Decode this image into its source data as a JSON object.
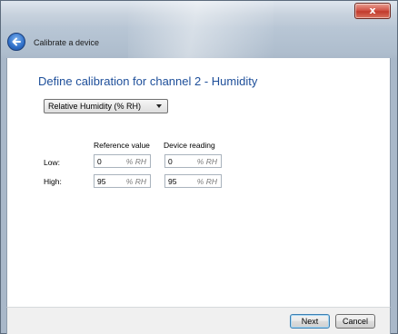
{
  "window": {
    "close_label": "x",
    "title": "Calibrate a device"
  },
  "main": {
    "heading": "Define calibration for channel 2 - Humidity",
    "unit_select": {
      "selected": "Relative Humidity (% RH)"
    },
    "columns": {
      "reference": "Reference value",
      "device": "Device reading"
    },
    "rows": [
      {
        "label": "Low:",
        "reference": "0",
        "reference_unit": "% RH",
        "device": "0",
        "device_unit": "% RH"
      },
      {
        "label": "High:",
        "reference": "95",
        "reference_unit": "% RH",
        "device": "95",
        "device_unit": "% RH"
      }
    ]
  },
  "footer": {
    "next_label": "Next",
    "cancel_label": "Cancel"
  },
  "icons": {
    "back": "back-arrow-icon",
    "close": "close-icon",
    "dropdown": "chevron-down-icon"
  }
}
